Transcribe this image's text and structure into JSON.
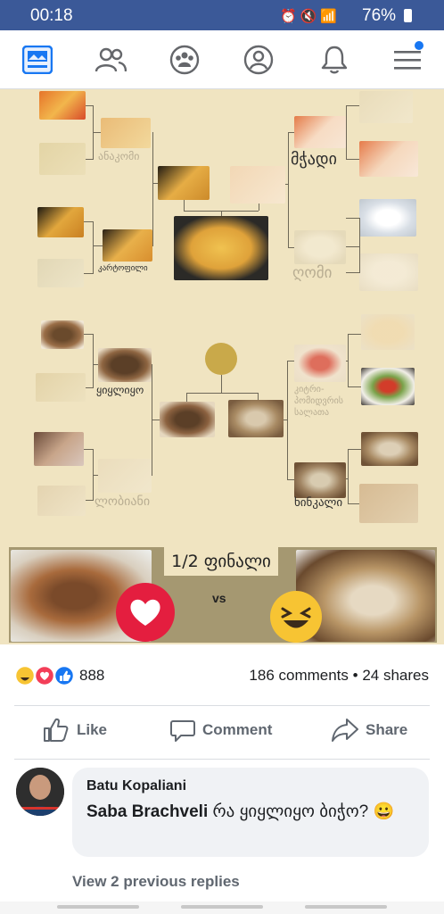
{
  "status_bar": {
    "time": "00:18",
    "battery": "76%"
  },
  "nav": {
    "icons": [
      "news-feed-icon",
      "friends-icon",
      "groups-icon",
      "profile-icon",
      "notifications-icon",
      "menu-icon"
    ],
    "active": "news-feed-icon",
    "accent": "#1877f2"
  },
  "bracket": {
    "labels": {
      "anakomi": "ანაკომი",
      "kartopili": "კარტოფილი",
      "mchadi": "მჭადი",
      "gomi": "ღომი",
      "kiyliyo": "ყიყლიყო",
      "lobiani": "ლობიანი",
      "salad": "კიტრი-პომიდვრის სალათა",
      "khinkali": "ხინკალი"
    },
    "semi_final": "1/2 ფინალი",
    "vs": "vs"
  },
  "reactions": {
    "count": "888",
    "comments": "186 comments",
    "separator": "•",
    "shares": "24 shares"
  },
  "actions": {
    "like": "Like",
    "comment": "Comment",
    "share": "Share"
  },
  "comment": {
    "author": "Batu Kopaliani",
    "mention": "Saba Brachveli",
    "text": " რა ყიყლიყო ბიჭო? 😀",
    "view_previous": "View 2 previous replies"
  }
}
